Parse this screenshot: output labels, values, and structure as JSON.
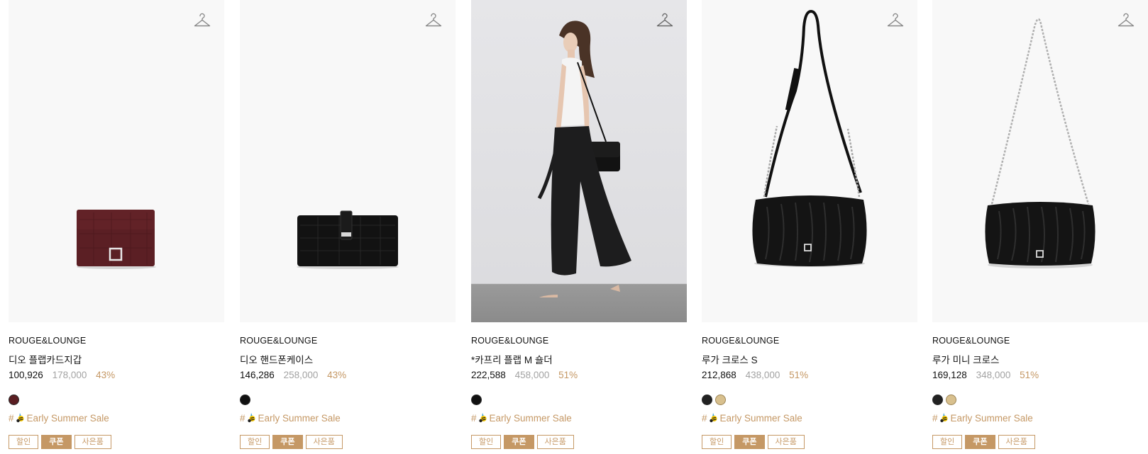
{
  "products": [
    {
      "brand": "ROUGE&LOUNGE",
      "name": "디오 플랩카드지갑",
      "price": "100,926",
      "original_price": "178,000",
      "discount": "43%",
      "swatches": [
        "#5a1e22"
      ],
      "tag": "Early Summer Sale",
      "badges": [
        "할인",
        "쿠폰",
        "사은품"
      ]
    },
    {
      "brand": "ROUGE&LOUNGE",
      "name": "디오 핸드폰케이스",
      "price": "146,286",
      "original_price": "258,000",
      "discount": "43%",
      "swatches": [
        "#111111"
      ],
      "tag": "Early Summer Sale",
      "badges": [
        "할인",
        "쿠폰",
        "사은품"
      ]
    },
    {
      "brand": "ROUGE&LOUNGE",
      "name": "*카프리 플랩 M 숄더",
      "price": "222,588",
      "original_price": "458,000",
      "discount": "51%",
      "swatches": [
        "#111111"
      ],
      "tag": "Early Summer Sale",
      "badges": [
        "할인",
        "쿠폰",
        "사은품"
      ]
    },
    {
      "brand": "ROUGE&LOUNGE",
      "name": "루가 크로스 S",
      "price": "212,868",
      "original_price": "438,000",
      "discount": "51%",
      "swatches": [
        "#222222",
        "#d8c08e"
      ],
      "tag": "Early Summer Sale",
      "badges": [
        "할인",
        "쿠폰",
        "사은품"
      ]
    },
    {
      "brand": "ROUGE&LOUNGE",
      "name": "루가 미니 크로스",
      "price": "169,128",
      "original_price": "348,000",
      "discount": "51%",
      "swatches": [
        "#222222",
        "#d8c08e"
      ],
      "tag": "Early Summer Sale",
      "badges": [
        "할인",
        "쿠폰",
        "사은품"
      ]
    }
  ],
  "tag_prefix": "#",
  "colors": {
    "accent": "#c59865",
    "muted": "#a3a3a3"
  },
  "icons": {
    "wishlist": "hanger-icon",
    "tag": "bee-emoji-icon"
  }
}
